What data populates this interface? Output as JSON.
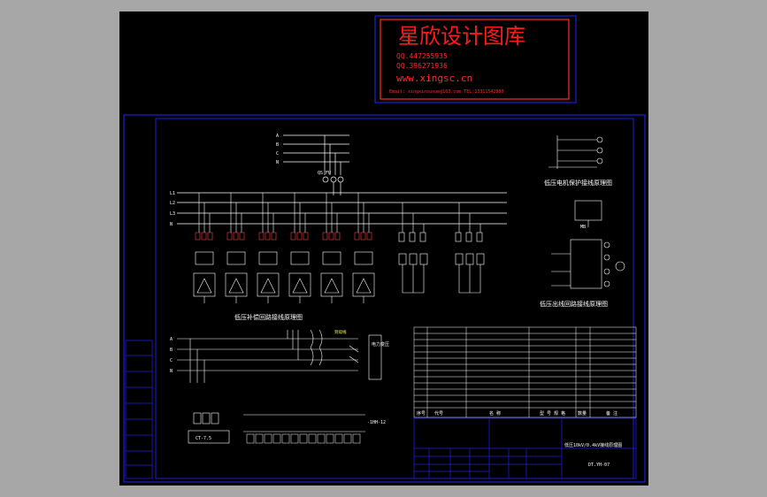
{
  "stamp": {
    "title": "星欣设计图库",
    "qq1": "QQ.447255935",
    "qq2": "QQ.396271936",
    "website": "www.xingsc.cn",
    "email": "Email: xingxinsuxue@163.com   TEL:13311542880"
  },
  "captions": {
    "capacitor_diagram": "低压补偿回路接线原理图",
    "motor_diagram": "低压电机保护接线原理图",
    "outlet_diagram": "低压出线回路接线原理图",
    "bus_right": "到母线",
    "right_box": "电力变压"
  },
  "title_block": {
    "drawing_title": "低压10kV/0.4kV接线原理图",
    "drawing_number": "DT.YH-07",
    "list_footer": [
      "序号",
      "代号",
      "名 称",
      "型 号 规 格",
      "数量",
      "备 注"
    ]
  },
  "bus_labels": [
    "A",
    "B",
    "C",
    "N"
  ],
  "bus_labels_mid": [
    "L1",
    "L2",
    "L3",
    "N"
  ],
  "bus_labels_low": [
    "A",
    "B",
    "C",
    "N"
  ],
  "device_labels": {
    "fuse_group": "QS FU",
    "meter_box": "MB",
    "outgoing": "-1HH-12",
    "ct_box": "CT-7.5"
  },
  "colors": {
    "frame": "#1f1fd6",
    "stamp_text": "#ff1a1a",
    "line": "#ffffff",
    "accent_red": "#ff4040",
    "accent_yellow": "#ffff40"
  }
}
